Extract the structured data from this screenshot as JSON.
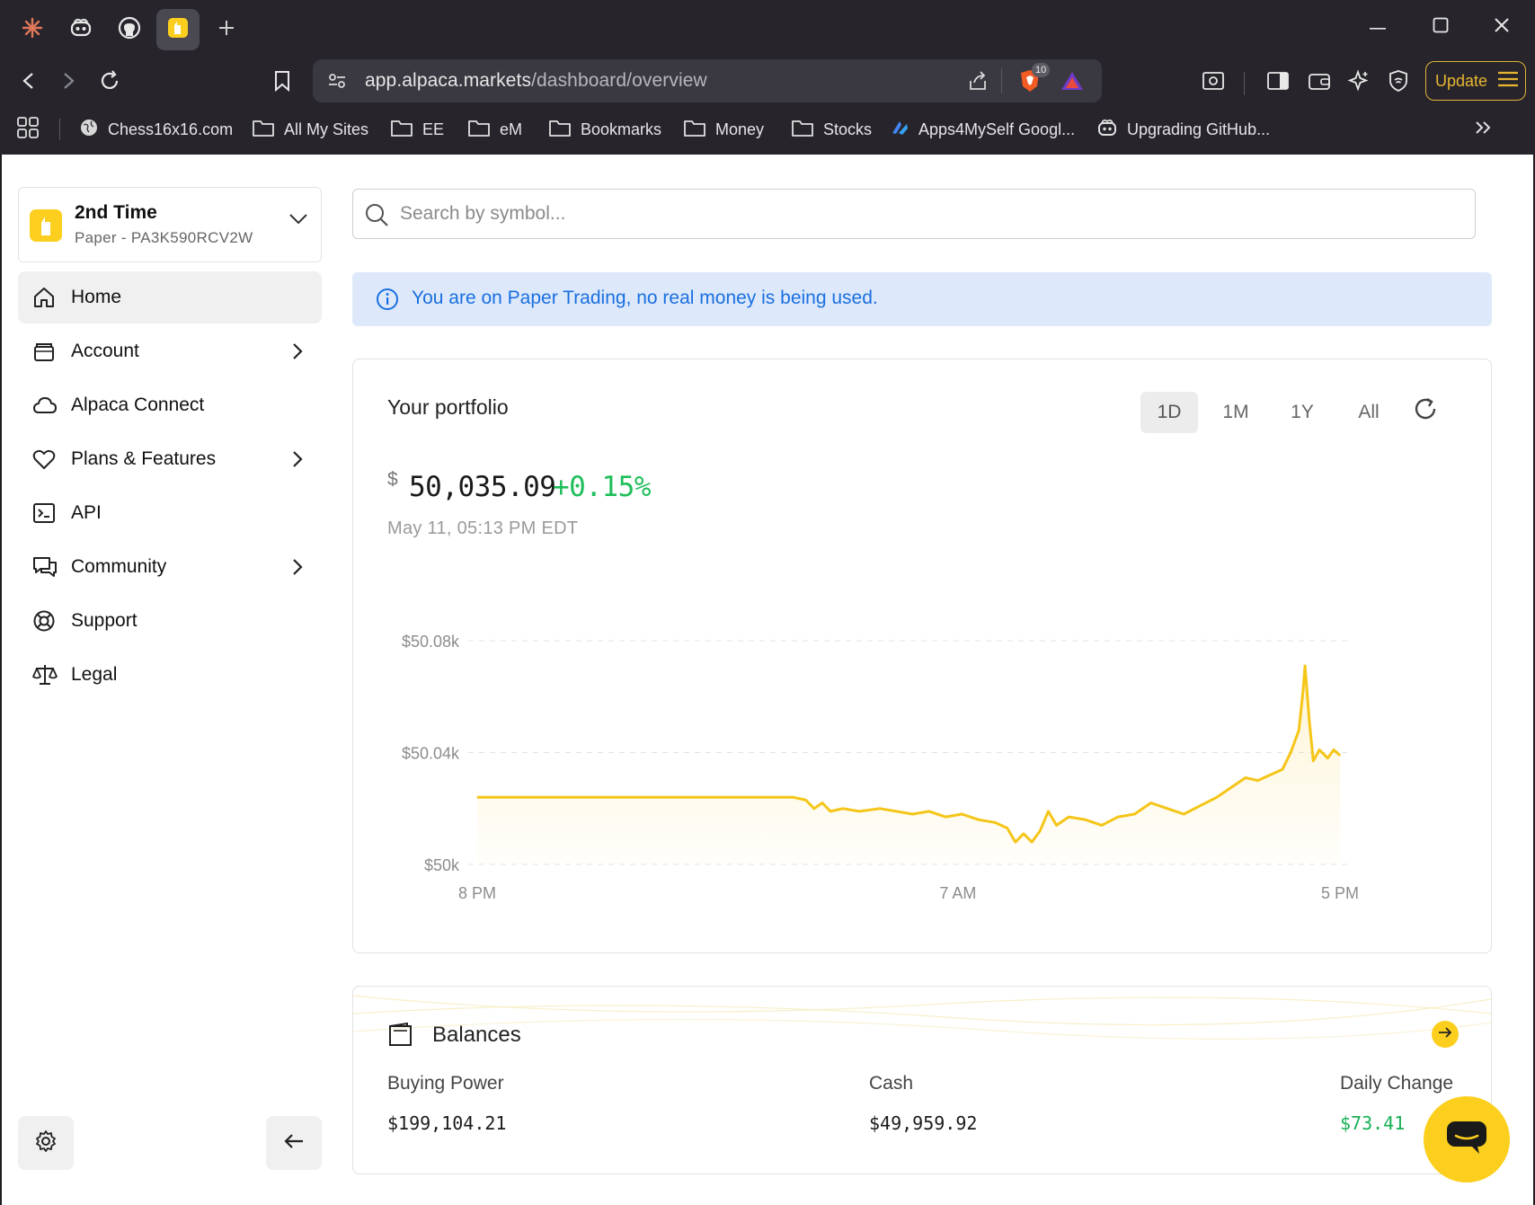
{
  "browser": {
    "url_host": "app.alpaca.markets",
    "url_path": "/dashboard/overview",
    "shield_count": "10",
    "update_label": "Update",
    "bookmarks": [
      {
        "icon": "globe-icon",
        "label": "Chess16x16.com"
      },
      {
        "icon": "folder-icon",
        "label": "All My Sites"
      },
      {
        "icon": "folder-icon",
        "label": "EE"
      },
      {
        "icon": "folder-icon",
        "label": "eM"
      },
      {
        "icon": "folder-icon",
        "label": "Bookmarks"
      },
      {
        "icon": "folder-icon",
        "label": "Money"
      },
      {
        "icon": "folder-icon",
        "label": "Stocks"
      },
      {
        "icon": "apps-script-icon",
        "label": "Apps4MySelf Googl..."
      },
      {
        "icon": "copilot-icon",
        "label": "Upgrading GitHub..."
      }
    ]
  },
  "account": {
    "name": "2nd Time",
    "subtitle": "Paper - PA3K590RCV2W"
  },
  "nav": {
    "items": [
      {
        "label": "Home",
        "icon": "home-icon",
        "active": true,
        "has_arrow": false
      },
      {
        "label": "Account",
        "icon": "wallet-icon",
        "active": false,
        "has_arrow": true
      },
      {
        "label": "Alpaca Connect",
        "icon": "cloud-icon",
        "active": false,
        "has_arrow": false
      },
      {
        "label": "Plans & Features",
        "icon": "heart-icon",
        "active": false,
        "has_arrow": true
      },
      {
        "label": "API",
        "icon": "terminal-icon",
        "active": false,
        "has_arrow": false
      },
      {
        "label": "Community",
        "icon": "chat-bubbles-icon",
        "active": false,
        "has_arrow": true
      },
      {
        "label": "Support",
        "icon": "lifebuoy-icon",
        "active": false,
        "has_arrow": false
      },
      {
        "label": "Legal",
        "icon": "scales-icon",
        "active": false,
        "has_arrow": false
      }
    ]
  },
  "search": {
    "placeholder": "Search by symbol..."
  },
  "notice": {
    "text": "You are on Paper Trading, no real money is being used."
  },
  "portfolio": {
    "title": "Your portfolio",
    "ranges": [
      "1D",
      "1M",
      "1Y",
      "All"
    ],
    "selected_range": "1D",
    "currency_symbol": "$",
    "value": "50,035.09",
    "change": "+0.15%",
    "date": "May 11, 05:13 PM EDT"
  },
  "chart_data": {
    "type": "area",
    "x_ticks": [
      "8 PM",
      "7 AM",
      "5 PM"
    ],
    "y_ticks": [
      "$50.08k",
      "$50.04k",
      "$50k"
    ],
    "ylim": [
      50000,
      50080
    ],
    "x_range_hours": [
      0,
      21
    ],
    "grid": true,
    "color": "#f5c518",
    "points": [
      [
        0,
        50024
      ],
      [
        3.5,
        50024
      ],
      [
        6.5,
        50024
      ],
      [
        7.7,
        50024
      ],
      [
        8.0,
        50023
      ],
      [
        8.2,
        50020
      ],
      [
        8.4,
        50022
      ],
      [
        8.6,
        50019
      ],
      [
        8.9,
        50020
      ],
      [
        9.3,
        50019
      ],
      [
        9.8,
        50020
      ],
      [
        10.2,
        50019
      ],
      [
        10.6,
        50018
      ],
      [
        11.0,
        50019
      ],
      [
        11.4,
        50017
      ],
      [
        11.8,
        50018
      ],
      [
        12.2,
        50016
      ],
      [
        12.6,
        50015
      ],
      [
        12.9,
        50013
      ],
      [
        13.1,
        50008
      ],
      [
        13.3,
        50011
      ],
      [
        13.5,
        50008
      ],
      [
        13.7,
        50012
      ],
      [
        13.9,
        50019
      ],
      [
        14.1,
        50014
      ],
      [
        14.4,
        50017
      ],
      [
        14.8,
        50016
      ],
      [
        15.2,
        50014
      ],
      [
        15.6,
        50017
      ],
      [
        16.0,
        50018
      ],
      [
        16.4,
        50022
      ],
      [
        16.8,
        50020
      ],
      [
        17.2,
        50018
      ],
      [
        17.6,
        50021
      ],
      [
        18.0,
        50024
      ],
      [
        18.4,
        50028
      ],
      [
        18.7,
        50031
      ],
      [
        19.0,
        50030
      ],
      [
        19.3,
        50032
      ],
      [
        19.6,
        50034
      ],
      [
        19.8,
        50040
      ],
      [
        20.0,
        50048
      ],
      [
        20.1,
        50062
      ],
      [
        20.15,
        50071
      ],
      [
        20.25,
        50052
      ],
      [
        20.35,
        50037
      ],
      [
        20.5,
        50041
      ],
      [
        20.7,
        50038
      ],
      [
        20.85,
        50041
      ],
      [
        21.0,
        50039
      ]
    ]
  },
  "balances": {
    "title": "Balances",
    "items": [
      {
        "label": "Buying Power",
        "value": "$199,104.21"
      },
      {
        "label": "Cash",
        "value": "$49,959.92"
      },
      {
        "label": "Daily Change",
        "value": "$73.41"
      }
    ]
  }
}
